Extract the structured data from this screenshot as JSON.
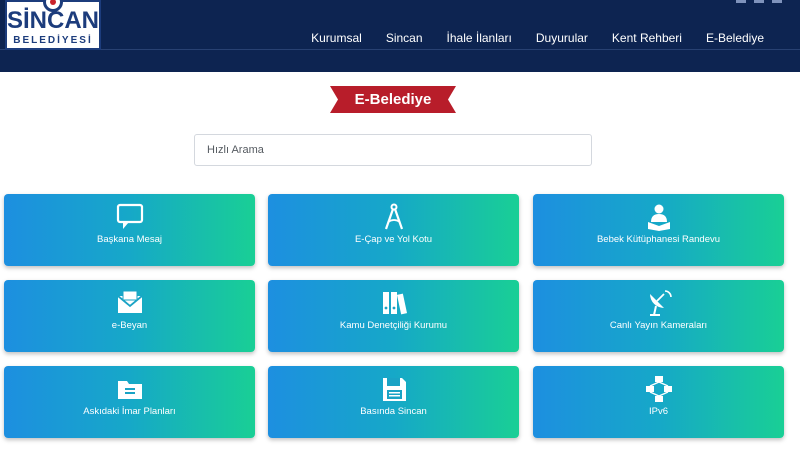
{
  "header": {
    "logo": {
      "name": "SİNCAN",
      "sub": "BELEDİYESİ"
    },
    "nav": [
      "Kurumsal",
      "Sincan",
      "İhale İlanları",
      "Duyurular",
      "Kent Rehberi",
      "E-Belediye"
    ]
  },
  "page_title": "E-Belediye",
  "search": {
    "placeholder": "Hızlı Arama",
    "value": ""
  },
  "tiles": [
    {
      "label": "Başkana Mesaj",
      "icon": "chat-bubble-icon"
    },
    {
      "label": "E-Çap ve Yol Kotu",
      "icon": "compass-icon"
    },
    {
      "label": "Bebek Kütüphanesi Randevu",
      "icon": "reader-icon"
    },
    {
      "label": "e-Beyan",
      "icon": "envelope-icon"
    },
    {
      "label": "Kamu Denetçiliği Kurumu",
      "icon": "binders-icon"
    },
    {
      "label": "Canlı Yayın Kameraları",
      "icon": "satellite-dish-icon"
    },
    {
      "label": "Askıdaki İmar Planları",
      "icon": "folder-icon"
    },
    {
      "label": "Basında Sincan",
      "icon": "floppy-disk-icon"
    },
    {
      "label": "IPv6",
      "icon": "network-icon"
    }
  ],
  "colors": {
    "header_bg": "#0d2451",
    "ribbon": "#b81d2a",
    "tile_gradient_start": "#1d8fe0",
    "tile_gradient_end": "#19cf95"
  }
}
